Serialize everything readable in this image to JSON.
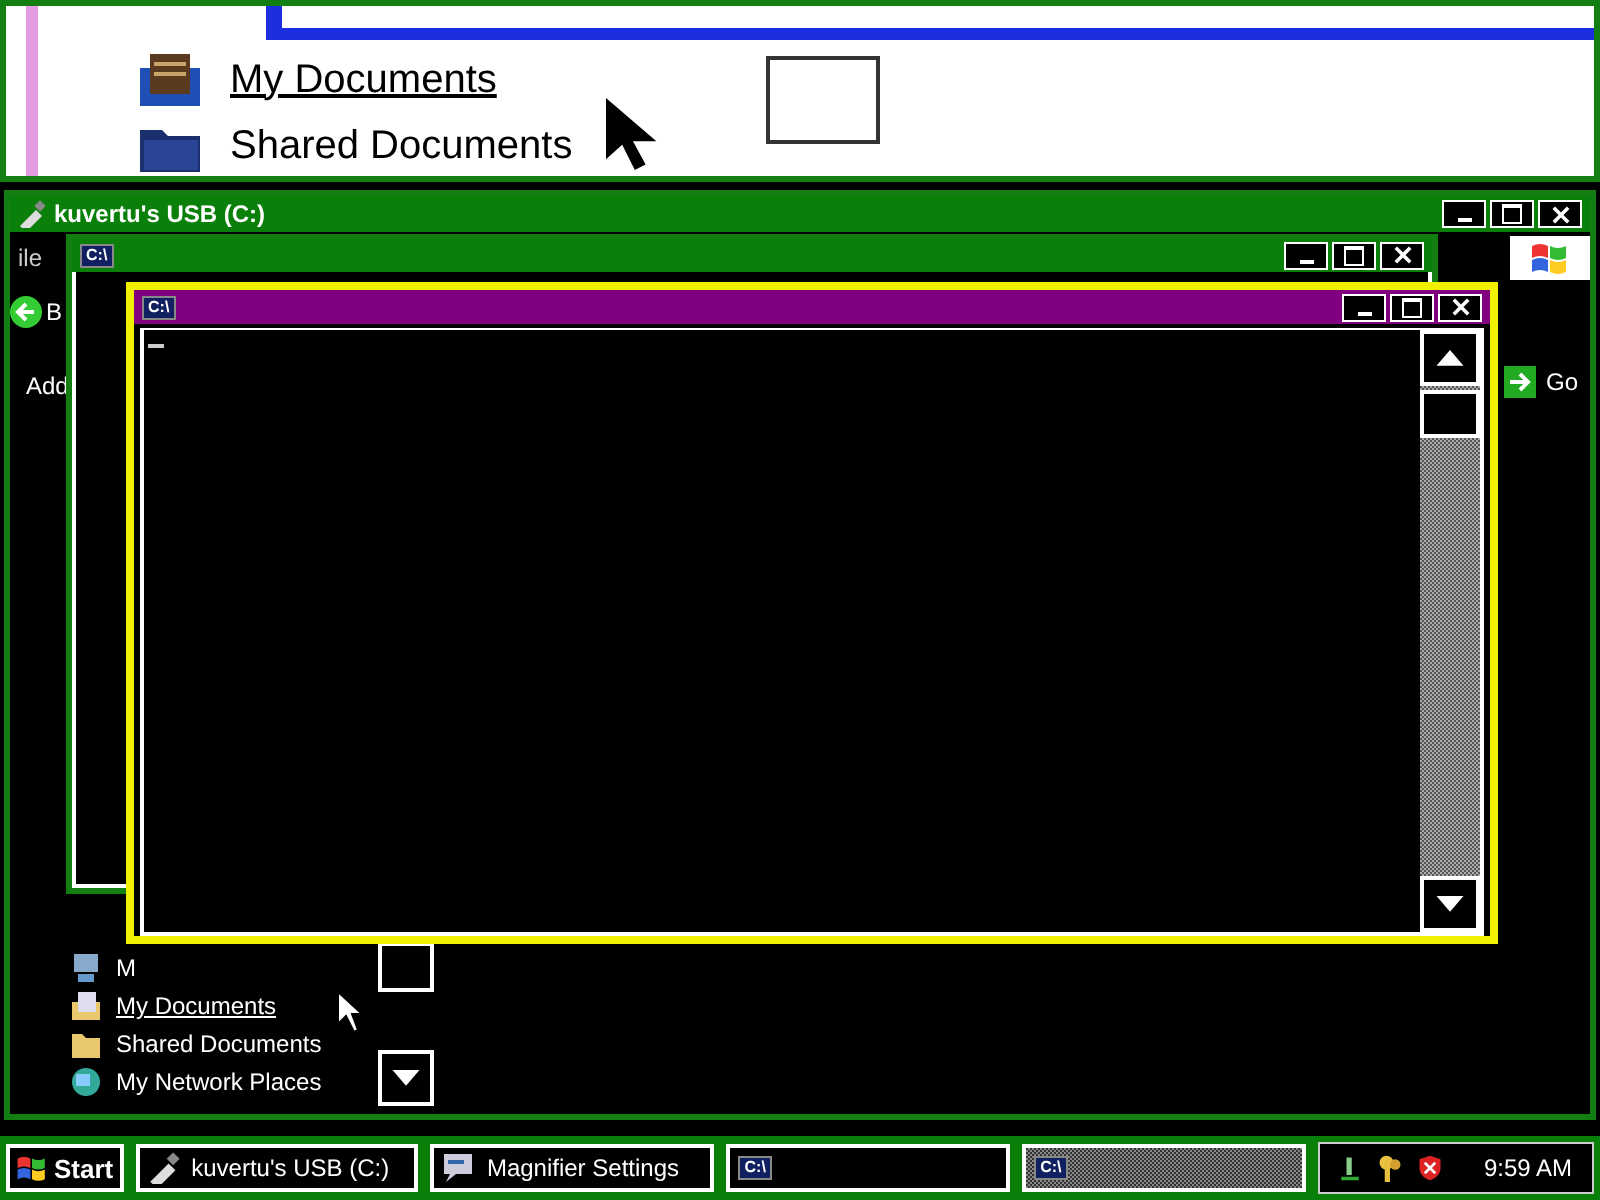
{
  "magnifier_view": {
    "items": [
      {
        "label": "My Documents",
        "kind": "documents",
        "underlined": true
      },
      {
        "label": "Shared Documents",
        "kind": "folder",
        "underlined": false
      }
    ]
  },
  "explorer_window": {
    "title": "kuvertu's USB (C:)",
    "menu_fragment": "ile",
    "back_fragment": "B",
    "address_fragment": "Add",
    "go_button": "Go",
    "places": [
      {
        "label": "M",
        "kind": "computer",
        "underlined": false
      },
      {
        "label": "My Documents",
        "kind": "documents",
        "underlined": true
      },
      {
        "label": "Shared Documents",
        "kind": "folder",
        "underlined": false
      },
      {
        "label": "My Network Places",
        "kind": "network",
        "underlined": false
      }
    ]
  },
  "console_back": {
    "icon_text": "C:\\"
  },
  "console_front": {
    "icon_text": "C:\\"
  },
  "taskbar": {
    "start": "Start",
    "buttons": [
      {
        "label": "kuvertu's USB (C:)",
        "kind": "usb",
        "selected": false
      },
      {
        "label": "Magnifier Settings",
        "kind": "magnifier",
        "selected": false
      },
      {
        "label": "C:\\",
        "kind": "console",
        "selected": false
      },
      {
        "label": "C:\\",
        "kind": "console",
        "selected": true
      }
    ],
    "clock": "9:59 AM"
  }
}
